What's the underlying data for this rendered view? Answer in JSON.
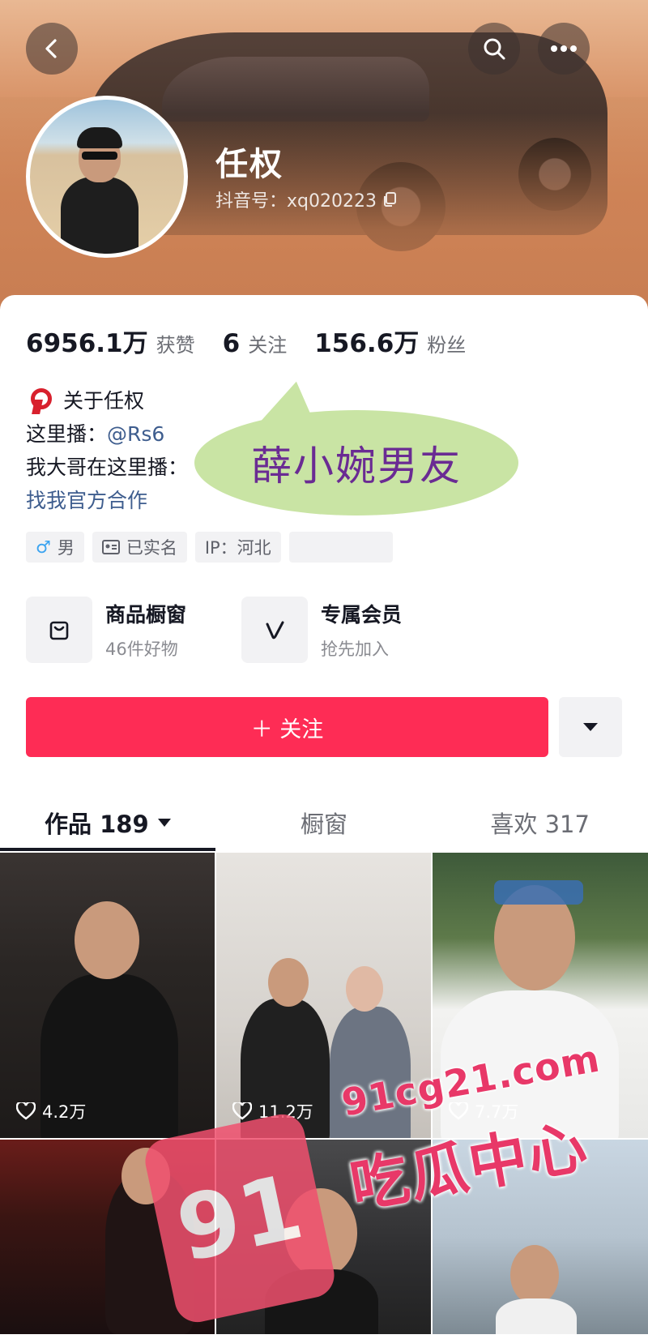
{
  "profile": {
    "name": "任权",
    "douyin_id": "抖音号：xq020223"
  },
  "stats": {
    "likes_value": "6956.1万",
    "likes_label": "获赞",
    "following_value": "6",
    "following_label": "关注",
    "followers_value": "156.6万",
    "followers_label": "粉丝"
  },
  "bio": {
    "about": "关于任权",
    "line2_prefix": "这里播：",
    "line2_mention": "@Rs6",
    "line3": "我大哥在这里播：",
    "cooperation_link": "找我官方合作"
  },
  "tags": {
    "gender": "男",
    "verified": "已实名",
    "ip": "IP：河北"
  },
  "bubble_text": "薛小婉男友",
  "features": {
    "shop_title": "商品橱窗",
    "shop_sub": "46件好物",
    "member_title": "专属会员",
    "member_sub": "抢先加入"
  },
  "follow_button": "＋ 关注",
  "tabs": {
    "works": "作品 189",
    "window": "橱窗",
    "liked": "喜欢 317"
  },
  "videos": [
    {
      "likes": "4.2万"
    },
    {
      "likes": "11.2万"
    },
    {
      "likes": "7.7万"
    }
  ],
  "watermark": {
    "badge": "91",
    "url": "91cg21.com",
    "text": "吃瓜中心"
  },
  "icons": [
    "back-icon",
    "search-icon",
    "more-icon",
    "copy-icon",
    "ribbon-icon",
    "male-icon",
    "id-card-icon",
    "bag-icon",
    "v-icon",
    "caret-down-icon",
    "heart-icon"
  ],
  "colors": {
    "accent": "#fe2c55",
    "link": "#3e5d8e",
    "bubble": "#c9e4a4",
    "bubble_text": "#6a2b93"
  }
}
